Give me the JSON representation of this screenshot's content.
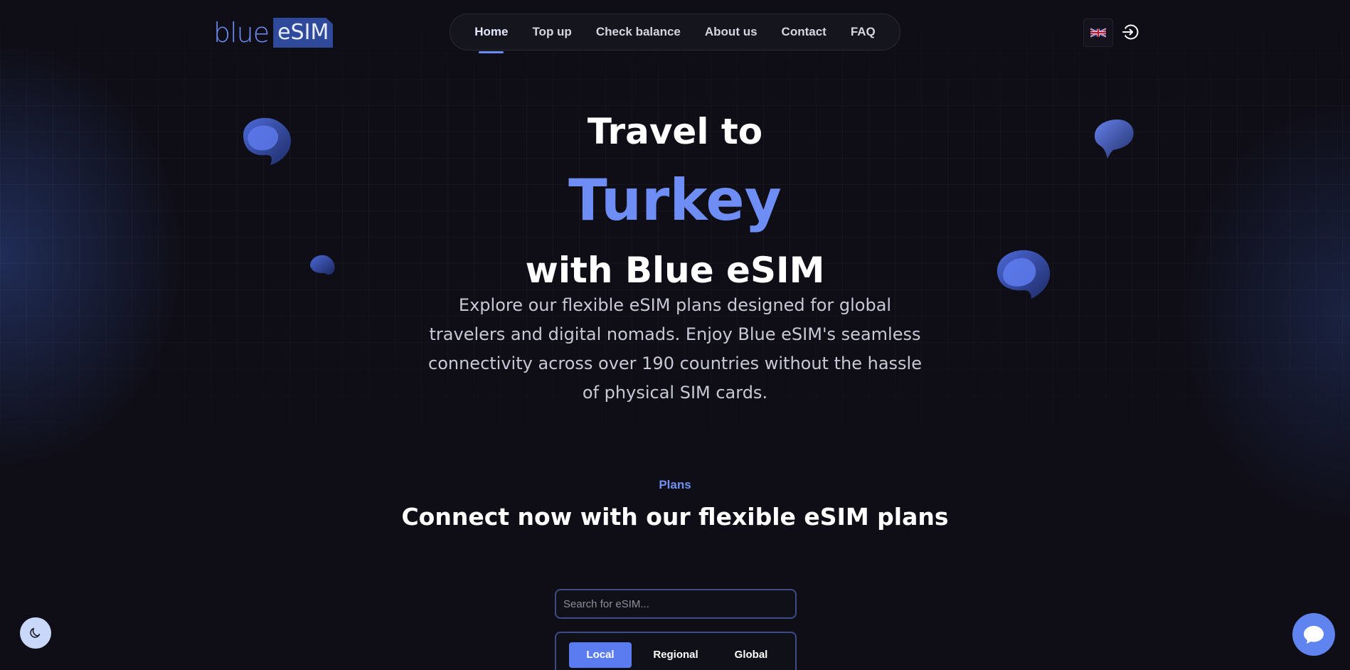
{
  "header": {
    "logo": {
      "part1": "blue",
      "part2": "eSIM"
    },
    "nav": [
      {
        "label": "Home",
        "active": true
      },
      {
        "label": "Top up",
        "active": false
      },
      {
        "label": "Check balance",
        "active": false
      },
      {
        "label": "About us",
        "active": false
      },
      {
        "label": "Contact",
        "active": false
      },
      {
        "label": "FAQ",
        "active": false
      }
    ],
    "language_icon": "uk-flag-icon",
    "login_icon": "sign-in-icon"
  },
  "hero": {
    "line1": "Travel to",
    "country": "Turkey",
    "line3": "with Blue eSIM",
    "description": "Explore our flexible eSIM plans designed for global travelers and digital nomads. Enjoy Blue eSIM's seamless connectivity across over 190 countries without the hassle of physical SIM cards."
  },
  "plans": {
    "eyebrow": "Plans",
    "title": "Connect now with our flexible eSIM plans",
    "search_placeholder": "Search for eSIM...",
    "tabs": [
      {
        "label": "Local",
        "active": true
      },
      {
        "label": "Regional",
        "active": false
      },
      {
        "label": "Global",
        "active": false
      }
    ]
  },
  "floating": {
    "theme_icon": "moon-icon",
    "chat_icon": "chat-bubble-icon"
  },
  "colors": {
    "background": "#0f0e17",
    "accent": "#6e8ef5",
    "active_tab": "#5a7cf0",
    "text": "#ffffff"
  }
}
